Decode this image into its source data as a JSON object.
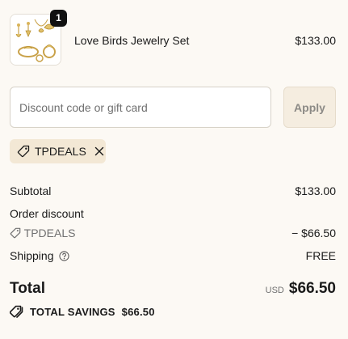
{
  "product": {
    "name": "Love Birds Jewelry Set",
    "price": "$133.00",
    "quantity": "1",
    "thumbnail_icon": "jewelry-product-image"
  },
  "discount": {
    "placeholder": "Discount code or gift card",
    "value": "",
    "apply_label": "Apply"
  },
  "applied_code": {
    "code": "TPDEALS",
    "icon": "tag-icon",
    "remove_icon": "close-icon"
  },
  "summary": {
    "subtotal_label": "Subtotal",
    "subtotal_value": "$133.00",
    "order_discount_label": "Order discount",
    "discount_code": "TPDEALS",
    "discount_value": "− $66.50",
    "shipping_label": "Shipping",
    "shipping_value": "FREE",
    "total_label": "Total",
    "currency": "USD",
    "total_value": "$66.50",
    "savings_label": "TOTAL SAVINGS",
    "savings_value": "$66.50"
  },
  "colors": {
    "background": "#fcf9f4",
    "chip": "#f3e8d5",
    "apply_button": "#f5ede0",
    "badge": "#111111"
  }
}
